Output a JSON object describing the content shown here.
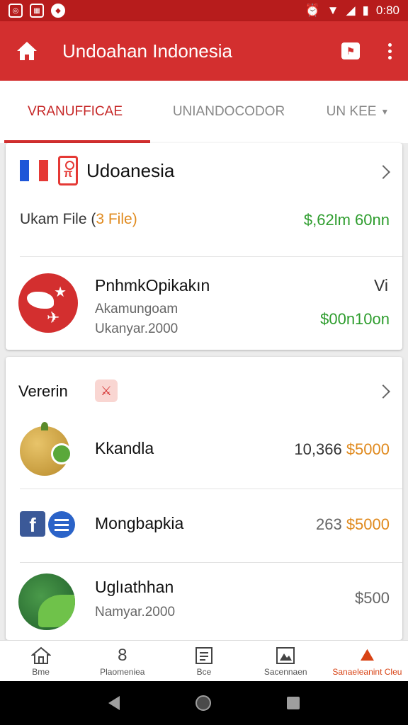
{
  "status_bar": {
    "time": "0:80",
    "left_icons": [
      "instagram-icon",
      "news-icon",
      "messenger-icon"
    ]
  },
  "app_bar": {
    "title": "Undoahan Indonesia"
  },
  "tabs": [
    {
      "label": "VRANUFFICAE",
      "active": true
    },
    {
      "label": "UNIANDOCODOR",
      "active": false
    },
    {
      "label": "UN KEE",
      "active": false
    }
  ],
  "card1": {
    "title": "Udoanesia",
    "file_label": "Ukam File (",
    "file_label_accent": "3 File)",
    "file_amount": "$,62lm 60nn",
    "item": {
      "name": "PnhmkOpikakın",
      "sub1": "Akamungoam",
      "sub2": "Ukanyar.2000",
      "badge": "Vi",
      "amount": "$00n10on"
    }
  },
  "card2": {
    "title": "Vererin",
    "rows": [
      {
        "name": "Kkandla",
        "count": "10,366",
        "money": "$5000"
      },
      {
        "name": "Mongbapkia",
        "count": "263",
        "money": "$5000"
      },
      {
        "name": "Uglıathhan",
        "sub": "Namyar.2000",
        "price": "$500"
      }
    ]
  },
  "bottom_nav": [
    {
      "icon": "home-icon",
      "label": "Bme"
    },
    {
      "icon": "number-icon",
      "glyph": "8",
      "label": "Plaomeniea"
    },
    {
      "icon": "document-icon",
      "label": "Bce"
    },
    {
      "icon": "image-icon",
      "label": "Sacennaen"
    },
    {
      "icon": "hiker-icon",
      "glyph": "⛰",
      "label": "Sanaeleanint Cleu",
      "active": true
    }
  ],
  "colors": {
    "primary": "#d32f2f",
    "status_bar": "#b71c1c",
    "positive": "#2e9d2e",
    "accent": "#e08a1e"
  }
}
